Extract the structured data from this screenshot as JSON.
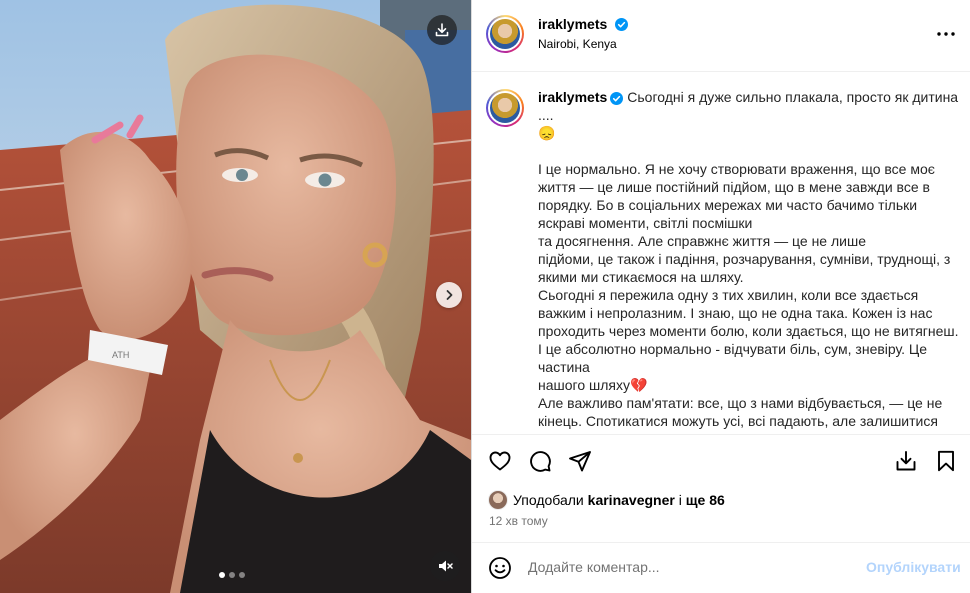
{
  "post": {
    "username": "iraklymets",
    "location": "Nairobi, Kenya",
    "verified_icon": "verified-badge-icon",
    "more_icon": "more-options-icon"
  },
  "caption": {
    "username": "iraklymets",
    "lines": [
      "Сьогодні я дуже сильно плакала, просто як дитина",
      "....",
      "😞",
      "",
      "І це нормально. Я не хочу створювати враження, що все моє",
      "життя — це лише постійний підйом, що в мене завжди все в",
      "порядку. Бо в соціальних мережах ми часто бачимо тільки",
      "яскраві моменти, світлі посмішки",
      "та досягнення. Але справжнє життя — це не лише",
      "підйоми, це також і падіння, розчарування, сумніви, труднощі, з",
      "якими ми стикаємося на шляху.",
      "Сьогодні я пережила одну з тих хвилин, коли все здається",
      "важким і непролазним. І знаю, що не одна така. Кожен із нас",
      "проходить через моменти болю, коли здається, що не витягнеш.",
      "І це абсолютно нормально - відчувати біль, сум, зневіру. Це",
      "частина",
      "нашого шляху💔",
      "Але важливо пам'ятати: все, що з нами відбувається, — це не",
      "кінець. Спотикатися можуть усі, всі падають, але залишитися"
    ]
  },
  "media": {
    "carousel_count": 3,
    "carousel_active": 0,
    "wristband_text": "ATH"
  },
  "likes": {
    "prefix": "Уподобали ",
    "user": "karinavegner",
    "middle": " і ",
    "count": "ще 86"
  },
  "time_ago": "12 хв тому",
  "comment": {
    "placeholder": "Додайте коментар...",
    "publish_label": "Опублікувати"
  },
  "colors": {
    "verified": "#0095f6",
    "publish_disabled": "#b3d4fc",
    "secondary_text": "#737373"
  }
}
